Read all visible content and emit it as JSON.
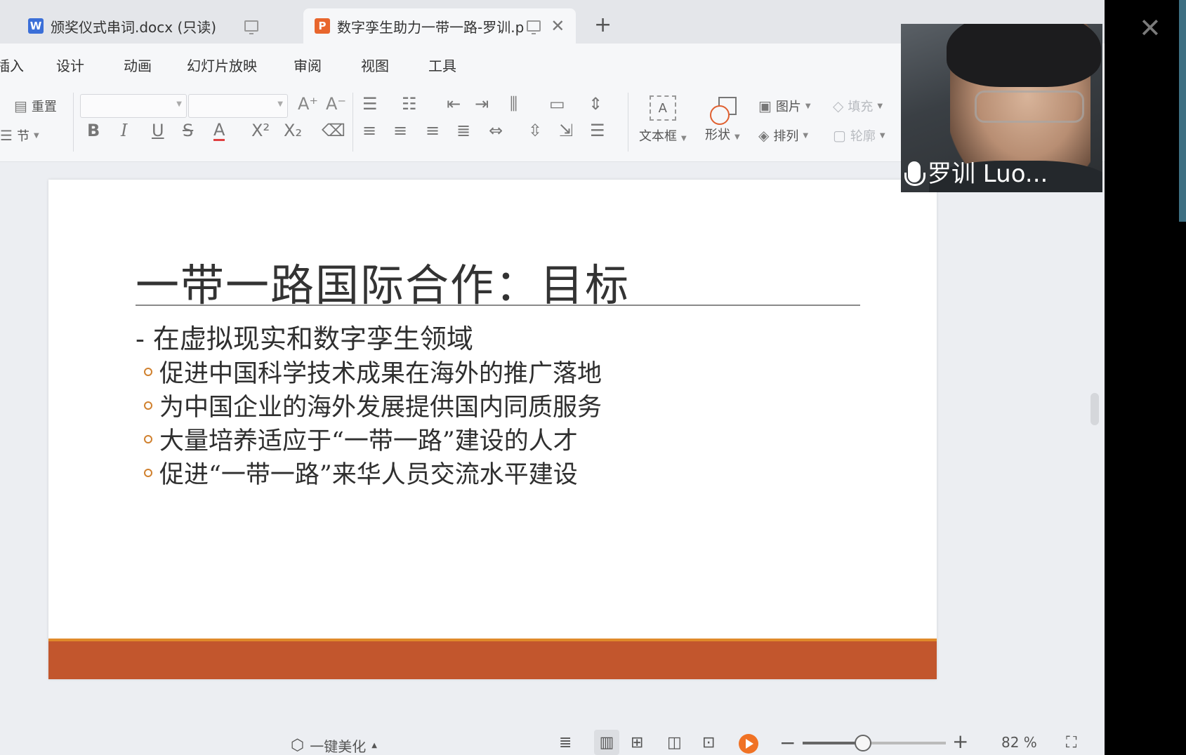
{
  "tabs": [
    {
      "label": "颁奖仪式串词.docx (只读)",
      "icon": "W",
      "color": "#3b6fd8"
    },
    {
      "label": "数字孪生助力一带一路-罗训.p",
      "icon": "P",
      "color": "#e8662d"
    }
  ],
  "menu": [
    "插入",
    "设计",
    "动画",
    "幻灯片放映",
    "审阅",
    "视图",
    "工具"
  ],
  "ribbon": {
    "reset": "重置",
    "section": "节",
    "textbox": "文本框",
    "shape": "形状",
    "picture": "图片",
    "arrange": "排列",
    "fill": "填充",
    "outline": "轮廓"
  },
  "slide": {
    "title": "一带一路国际合作：目标",
    "heading": "- 在虚拟现实和数字孪生领域",
    "bullets": [
      "促进中国科学技术成果在海外的推广落地",
      "为中国企业的海外发展提供国内同质服务",
      "大量培养适应于“一带一路”建设的人才",
      "促进“一带一路”来华人员交流水平建设"
    ],
    "accent_color": "#c2562d"
  },
  "status": {
    "beautify": "一键美化",
    "zoom": "82 %",
    "zoom_fraction": 0.42
  },
  "video": {
    "speaker": "罗训 Luo..."
  }
}
